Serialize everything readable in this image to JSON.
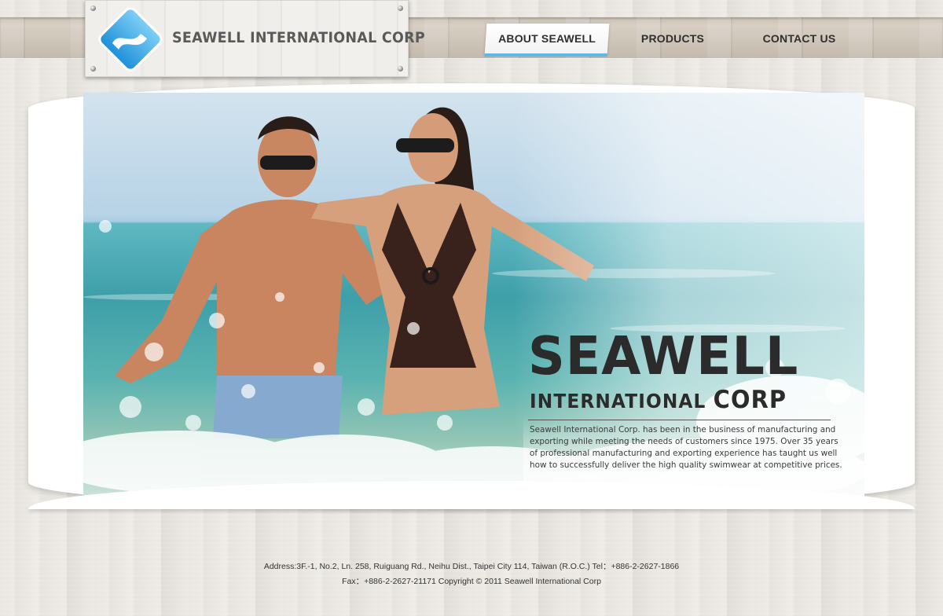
{
  "brand": {
    "logo_text": "SEAWELL INTERNATIONAL CORP",
    "colors": {
      "accent": "#5fb7e6",
      "logo_blue": "#3aa9e8"
    }
  },
  "nav": {
    "items": [
      {
        "label": "ABOUT SEAWELL",
        "active": true
      },
      {
        "label": "PRODUCTS",
        "active": false
      },
      {
        "label": "CONTACT US",
        "active": false
      }
    ]
  },
  "hero": {
    "headline": "SEAWELL",
    "sub_line_1": "INTERNATIONAL",
    "sub_line_2": "CORP",
    "description": "Seawell International Corp. has been in the business of manufacturing and exporting while meeting the needs of customers since 1975. Over 35 years of professional manufacturing and exporting experience has taught us well how to successfully deliver the high quality swimwear at competitive prices."
  },
  "footer": {
    "line_1": "Address:3F.-1, No.2, Ln. 258, Ruiguang Rd., Neihu Dist., Taipei City 114, Taiwan (R.O.C.)  Tel：+886-2-2627-1866",
    "line_2": "Fax：+886-2-2627-21171     Copyright © 2011 Seawell International Corp"
  }
}
